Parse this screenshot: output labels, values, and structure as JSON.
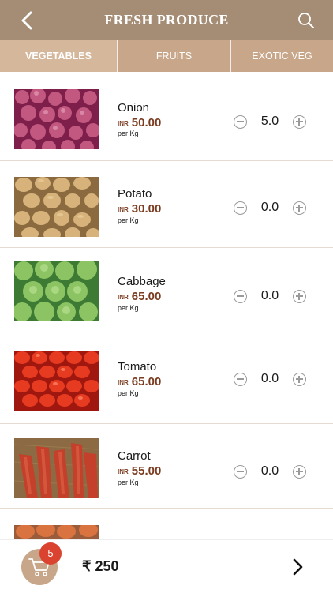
{
  "header": {
    "title": "FRESH PRODUCE",
    "back_icon": "chevron-left-icon",
    "search_icon": "search-icon"
  },
  "tabs": [
    {
      "label": "VEGETABLES",
      "active": true
    },
    {
      "label": "FRUITS",
      "active": false
    },
    {
      "label": "EXOTIC VEG",
      "active": false
    }
  ],
  "products": [
    {
      "name": "Onion",
      "currency": "INR",
      "price": "50.00",
      "unit": "per Kg",
      "qty": "5.0"
    },
    {
      "name": "Potato",
      "currency": "INR",
      "price": "30.00",
      "unit": "per Kg",
      "qty": "0.0"
    },
    {
      "name": "Cabbage",
      "currency": "INR",
      "price": "65.00",
      "unit": "per Kg",
      "qty": "0.0"
    },
    {
      "name": "Tomato",
      "currency": "INR",
      "price": "65.00",
      "unit": "per Kg",
      "qty": "0.0"
    },
    {
      "name": "Carrot",
      "currency": "INR",
      "price": "55.00",
      "unit": "per Kg",
      "qty": "0.0"
    }
  ],
  "footer": {
    "cart_count": "5",
    "total": "₹ 250",
    "cart_icon": "cart-icon",
    "next_icon": "chevron-right-icon"
  },
  "colors": {
    "header": "#a58c74",
    "tab_bar": "#c7a689",
    "tab_active": "#d5b79b",
    "price": "#7a3b1f",
    "badge": "#d9432f"
  }
}
